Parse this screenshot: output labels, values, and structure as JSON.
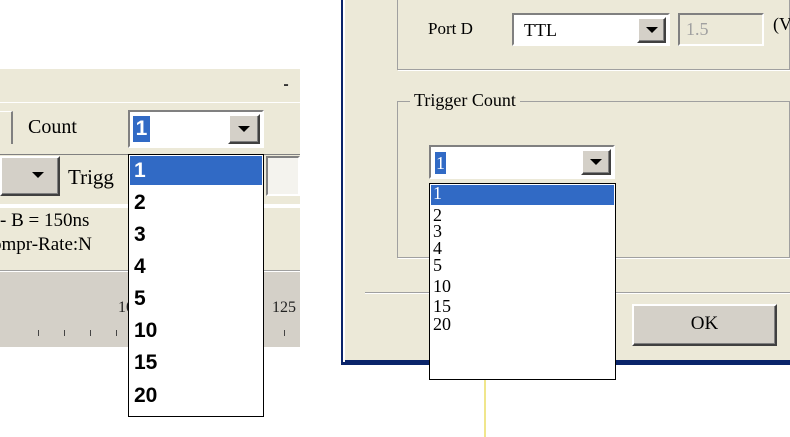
{
  "left_panel": {
    "minimize_glyph": "-",
    "count_label": "Count",
    "count_value": "1",
    "trigger_label": "Trigg",
    "info_line1": "- B = 150ns",
    "info_line2": "ompr-Rate:N",
    "ruler_labels": [
      "10",
      "125"
    ],
    "dropdown_options": [
      "1",
      "2",
      "3",
      "4",
      "5",
      "10",
      "15",
      "20"
    ],
    "selected_option": "1"
  },
  "right_dialog": {
    "port_label": "Port D",
    "port_value": "TTL",
    "port_voltage": "1.5",
    "unit_partial": "(V",
    "trigger_group_label": "Trigger Count",
    "trigger_value": "1",
    "ok_label": "OK",
    "dropdown_options": [
      "1",
      "2",
      "3",
      "4",
      "5",
      "10",
      "15",
      "20"
    ],
    "selected_option": "1"
  },
  "colors": {
    "selection": "#316ac5",
    "dialog_bg": "#ece9d8",
    "frame_blue": "#0a246a"
  }
}
